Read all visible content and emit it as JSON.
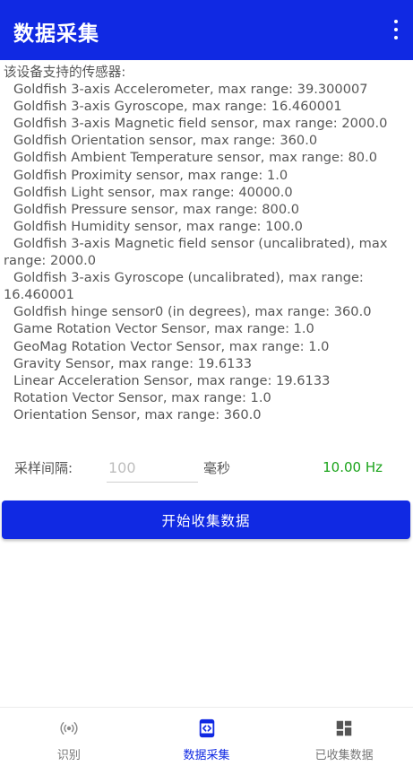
{
  "appbar": {
    "title": "数据采集",
    "menu_icon": "more-vert-icon"
  },
  "sensors": {
    "heading": "该设备支持的传感器:",
    "items": [
      "Goldfish 3-axis Accelerometer, max range: 39.300007",
      "Goldfish 3-axis Gyroscope, max range: 16.460001",
      "Goldfish 3-axis Magnetic field sensor, max range: 2000.0",
      "Goldfish Orientation sensor, max range: 360.0",
      "Goldfish Ambient Temperature sensor, max range: 80.0",
      "Goldfish Proximity sensor, max range: 1.0",
      "Goldfish Light sensor, max range: 40000.0",
      "Goldfish Pressure sensor, max range: 800.0",
      "Goldfish Humidity sensor, max range: 100.0",
      "Goldfish 3-axis Magnetic field sensor (uncalibrated), max range: 2000.0",
      "Goldfish 3-axis Gyroscope (uncalibrated), max range: 16.460001",
      "Goldfish hinge sensor0 (in degrees), max range: 360.0",
      "Game Rotation Vector Sensor, max range: 1.0",
      "GeoMag Rotation Vector Sensor, max range: 1.0",
      "Gravity Sensor, max range: 19.6133",
      "Linear Acceleration Sensor, max range: 19.6133",
      "Rotation Vector Sensor, max range: 1.0",
      "Orientation Sensor, max range: 360.0"
    ]
  },
  "interval": {
    "label": "采样间隔:",
    "placeholder": "100",
    "unit": "毫秒",
    "rate": "10.00 Hz"
  },
  "start_button": "开始收集数据",
  "nav": {
    "items": [
      {
        "label": "识别",
        "icon": "signal-broadcast-icon"
      },
      {
        "label": "数据采集",
        "icon": "data-collect-icon"
      },
      {
        "label": "已收集数据",
        "icon": "dashboard-icon"
      }
    ]
  },
  "colors": {
    "primary": "#1029e3",
    "rate_green": "#1aa31a"
  }
}
